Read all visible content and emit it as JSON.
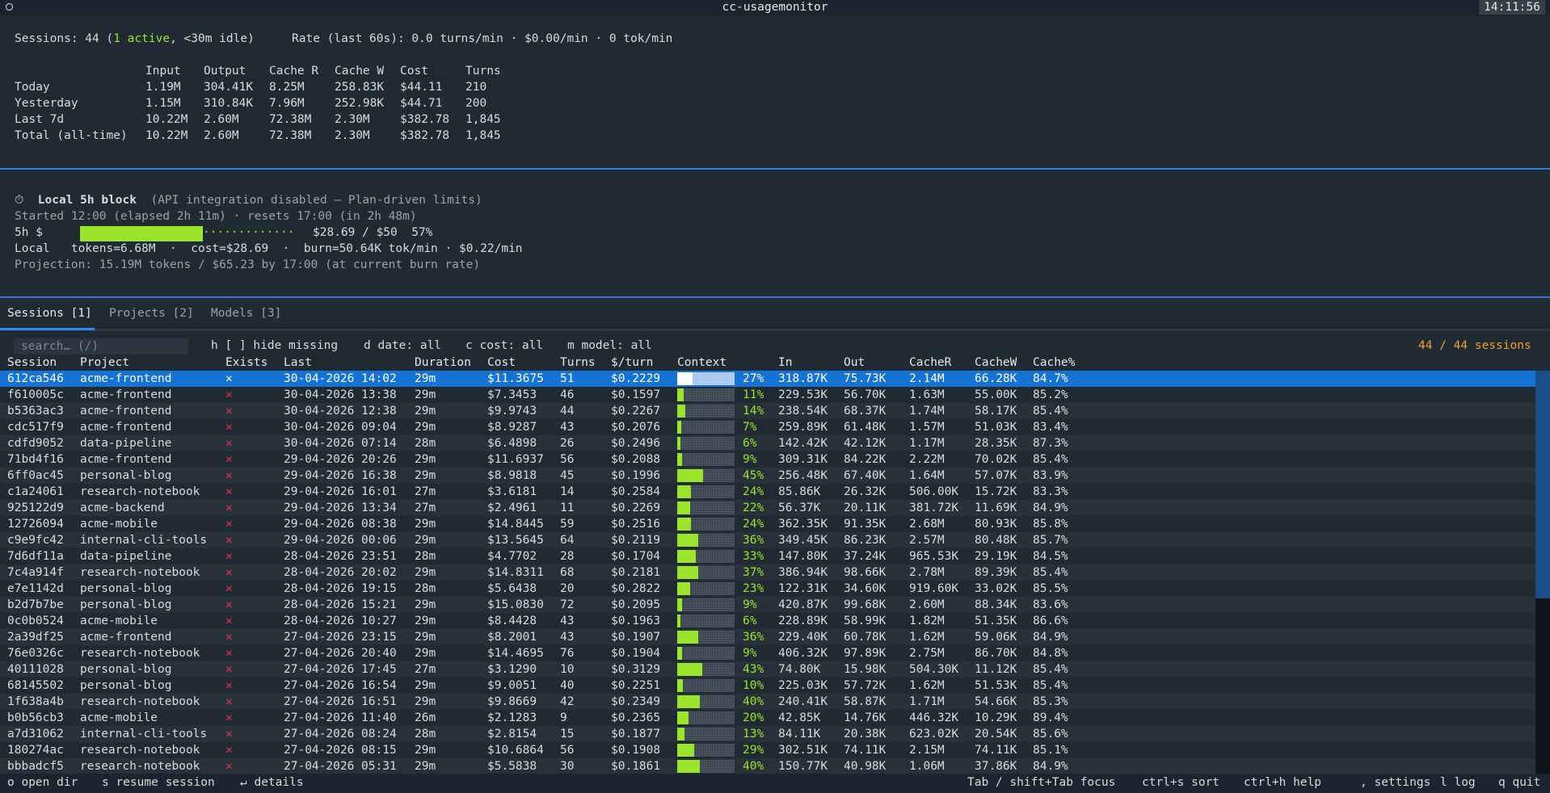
{
  "window": {
    "title": "cc-usagemonitor",
    "clock": "14:11:56"
  },
  "summary": {
    "sessions_label": "Sessions: 44 (",
    "active": "1 active",
    "sessions_tail": ", <30m idle)",
    "rate": "Rate (last 60s): 0.0 turns/min · $0.00/min · 0 tok/min",
    "columns": [
      "Input",
      "Output",
      "Cache R",
      "Cache W",
      "Cost",
      "Turns"
    ],
    "rows": [
      {
        "label": "Today",
        "cells": [
          "1.19M",
          "304.41K",
          "8.25M",
          "258.83K",
          "$44.11",
          "210"
        ]
      },
      {
        "label": "Yesterday",
        "cells": [
          "1.15M",
          "310.84K",
          "7.96M",
          "252.98K",
          "$44.71",
          "200"
        ]
      },
      {
        "label": "Last 7d",
        "cells": [
          "10.22M",
          "2.60M",
          "72.38M",
          "2.30M",
          "$382.78",
          "1,845"
        ]
      },
      {
        "label": "Total (all-time)",
        "cells": [
          "10.22M",
          "2.60M",
          "72.38M",
          "2.30M",
          "$382.78",
          "1,845"
        ]
      }
    ]
  },
  "block": {
    "icon": "stopwatch-icon",
    "title": "Local 5h block",
    "note": "(API integration disabled — Plan-driven limits)",
    "started": "Started 12:00 (elapsed 2h 11m) · resets 17:00 (in 2h 48m)",
    "gauge_label": "5h $",
    "gauge_dots": "·············",
    "gauge_value": "$28.69 / $50  57%",
    "gauge_fraction": 0.57,
    "local": "Local   tokens=6.68M  ·  cost=$28.69  ·  burn=50.64K tok/min · $0.22/min",
    "projection": "Projection: 15.19M tokens / $65.23 by 17:00 (at current burn rate)"
  },
  "tabs": [
    {
      "label": "Sessions [1]",
      "active": true
    },
    {
      "label": "Projects [2]",
      "active": false
    },
    {
      "label": "Models [3]",
      "active": false
    }
  ],
  "filters": {
    "search_placeholder": "search…  (/)",
    "hide_missing": "h [ ] hide missing",
    "date": "d date: all",
    "cost": "c cost: all",
    "model": "m model: all",
    "count": "44 / 44 sessions"
  },
  "table": {
    "headers": [
      "Session",
      "Project",
      "Exists",
      "Last",
      "Duration",
      "Cost",
      "Turns",
      "$/turn",
      "Context",
      "In",
      "Out",
      "CacheR",
      "CacheW",
      "Cache%"
    ],
    "rows": [
      [
        "612ca546",
        "acme-frontend",
        "✕",
        "30-04-2026 14:02",
        "29m",
        "$11.3675",
        "51",
        "$0.2229",
        27,
        "318.87K",
        "75.73K",
        "2.14M",
        "66.28K",
        "84.7%"
      ],
      [
        "f610005c",
        "acme-frontend",
        "✕",
        "30-04-2026 13:38",
        "29m",
        "$7.3453",
        "46",
        "$0.1597",
        11,
        "229.53K",
        "56.70K",
        "1.63M",
        "55.00K",
        "85.2%"
      ],
      [
        "b5363ac3",
        "acme-frontend",
        "✕",
        "30-04-2026 12:38",
        "29m",
        "$9.9743",
        "44",
        "$0.2267",
        14,
        "238.54K",
        "68.37K",
        "1.74M",
        "58.17K",
        "85.4%"
      ],
      [
        "cdc517f9",
        "acme-frontend",
        "✕",
        "30-04-2026 09:04",
        "29m",
        "$8.9287",
        "43",
        "$0.2076",
        7,
        "259.89K",
        "61.48K",
        "1.57M",
        "51.03K",
        "83.4%"
      ],
      [
        "cdfd9052",
        "data-pipeline",
        "✕",
        "30-04-2026 07:14",
        "28m",
        "$6.4898",
        "26",
        "$0.2496",
        6,
        "142.42K",
        "42.12K",
        "1.17M",
        "28.35K",
        "87.3%"
      ],
      [
        "71bd4f16",
        "acme-frontend",
        "✕",
        "29-04-2026 20:26",
        "29m",
        "$11.6937",
        "56",
        "$0.2088",
        9,
        "309.31K",
        "84.22K",
        "2.22M",
        "70.02K",
        "85.4%"
      ],
      [
        "6ff0ac45",
        "personal-blog",
        "✕",
        "29-04-2026 16:38",
        "29m",
        "$8.9818",
        "45",
        "$0.1996",
        45,
        "256.48K",
        "67.40K",
        "1.64M",
        "57.07K",
        "83.9%"
      ],
      [
        "c1a24061",
        "research-notebook",
        "✕",
        "29-04-2026 16:01",
        "27m",
        "$3.6181",
        "14",
        "$0.2584",
        24,
        "85.86K",
        "26.32K",
        "506.00K",
        "15.72K",
        "83.3%"
      ],
      [
        "925122d9",
        "acme-backend",
        "✕",
        "29-04-2026 13:34",
        "27m",
        "$2.4961",
        "11",
        "$0.2269",
        22,
        "56.37K",
        "20.11K",
        "381.72K",
        "11.69K",
        "84.9%"
      ],
      [
        "12726094",
        "acme-mobile",
        "✕",
        "29-04-2026 08:38",
        "29m",
        "$14.8445",
        "59",
        "$0.2516",
        24,
        "362.35K",
        "91.35K",
        "2.68M",
        "80.93K",
        "85.8%"
      ],
      [
        "c9e9fc42",
        "internal-cli-tools",
        "✕",
        "29-04-2026 00:06",
        "29m",
        "$13.5645",
        "64",
        "$0.2119",
        36,
        "349.45K",
        "86.23K",
        "2.57M",
        "80.48K",
        "85.7%"
      ],
      [
        "7d6df11a",
        "data-pipeline",
        "✕",
        "28-04-2026 23:51",
        "28m",
        "$4.7702",
        "28",
        "$0.1704",
        33,
        "147.80K",
        "37.24K",
        "965.53K",
        "29.19K",
        "84.5%"
      ],
      [
        "7c4a914f",
        "research-notebook",
        "✕",
        "28-04-2026 20:02",
        "29m",
        "$14.8311",
        "68",
        "$0.2181",
        37,
        "386.94K",
        "98.66K",
        "2.78M",
        "89.39K",
        "85.4%"
      ],
      [
        "e7e1142d",
        "personal-blog",
        "✕",
        "28-04-2026 19:15",
        "28m",
        "$5.6438",
        "20",
        "$0.2822",
        23,
        "122.31K",
        "34.60K",
        "919.60K",
        "33.02K",
        "85.5%"
      ],
      [
        "b2d7b7be",
        "personal-blog",
        "✕",
        "28-04-2026 15:21",
        "29m",
        "$15.0830",
        "72",
        "$0.2095",
        9,
        "420.87K",
        "99.68K",
        "2.60M",
        "88.34K",
        "83.6%"
      ],
      [
        "0c0b0524",
        "acme-mobile",
        "✕",
        "28-04-2026 10:27",
        "29m",
        "$8.4428",
        "43",
        "$0.1963",
        6,
        "228.89K",
        "58.99K",
        "1.82M",
        "51.35K",
        "86.6%"
      ],
      [
        "2a39df25",
        "acme-frontend",
        "✕",
        "27-04-2026 23:15",
        "29m",
        "$8.2001",
        "43",
        "$0.1907",
        36,
        "229.40K",
        "60.78K",
        "1.62M",
        "59.06K",
        "84.9%"
      ],
      [
        "76e0326c",
        "research-notebook",
        "✕",
        "27-04-2026 20:40",
        "29m",
        "$14.4695",
        "76",
        "$0.1904",
        9,
        "406.32K",
        "97.89K",
        "2.75M",
        "86.70K",
        "84.8%"
      ],
      [
        "40111028",
        "personal-blog",
        "✕",
        "27-04-2026 17:45",
        "27m",
        "$3.1290",
        "10",
        "$0.3129",
        43,
        "74.80K",
        "15.98K",
        "504.30K",
        "11.12K",
        "85.4%"
      ],
      [
        "68145502",
        "personal-blog",
        "✕",
        "27-04-2026 16:54",
        "29m",
        "$9.0051",
        "40",
        "$0.2251",
        10,
        "225.03K",
        "57.72K",
        "1.62M",
        "51.53K",
        "85.4%"
      ],
      [
        "1f638a4b",
        "research-notebook",
        "✕",
        "27-04-2026 16:51",
        "29m",
        "$9.8669",
        "42",
        "$0.2349",
        40,
        "240.41K",
        "58.87K",
        "1.71M",
        "54.66K",
        "85.3%"
      ],
      [
        "b0b56cb3",
        "acme-mobile",
        "✕",
        "27-04-2026 11:40",
        "26m",
        "$2.1283",
        "9",
        "$0.2365",
        20,
        "42.85K",
        "14.76K",
        "446.32K",
        "10.29K",
        "89.4%"
      ],
      [
        "a7d31062",
        "internal-cli-tools",
        "✕",
        "27-04-2026 08:24",
        "28m",
        "$2.8154",
        "15",
        "$0.1877",
        13,
        "84.11K",
        "20.38K",
        "623.02K",
        "20.54K",
        "85.6%"
      ],
      [
        "180274ac",
        "research-notebook",
        "✕",
        "27-04-2026 08:15",
        "29m",
        "$10.6864",
        "56",
        "$0.1908",
        29,
        "302.51K",
        "74.11K",
        "2.15M",
        "74.11K",
        "85.1%"
      ],
      [
        "bbbadcf5",
        "research-notebook",
        "✕",
        "27-04-2026 05:31",
        "29m",
        "$5.5838",
        "30",
        "$0.1861",
        40,
        "150.77K",
        "40.98K",
        "1.06M",
        "37.86K",
        "84.9%"
      ]
    ]
  },
  "footer": {
    "left": [
      "o open dir",
      "s resume session",
      "↵ details"
    ],
    "right": [
      "Tab / shift+Tab focus",
      "ctrl+s sort",
      "ctrl+h help",
      ", settings",
      "l log",
      "q quit"
    ]
  }
}
